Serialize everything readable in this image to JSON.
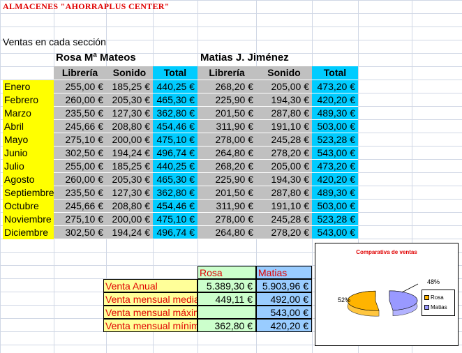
{
  "sheet": {
    "title": "ALMACENES \"AHORRAPLUS CENTER\"",
    "subtitle": "Ventas en cada sección",
    "persons": [
      "Rosa Mª Mateos",
      "Matias J. Jiménez"
    ],
    "columns": [
      "Librería",
      "Sonido",
      "Total",
      "Librería",
      "Sonido",
      "Total"
    ],
    "rows": [
      {
        "month": "Enero",
        "v": [
          "255,00 €",
          "185,25 €",
          "440,25 €",
          "268,20 €",
          "205,00 €",
          "473,20 €"
        ]
      },
      {
        "month": "Febrero",
        "v": [
          "260,00 €",
          "205,30 €",
          "465,30 €",
          "225,90 €",
          "194,30 €",
          "420,20 €"
        ]
      },
      {
        "month": "Marzo",
        "v": [
          "235,50 €",
          "127,30 €",
          "362,80 €",
          "201,50 €",
          "287,80 €",
          "489,30 €"
        ]
      },
      {
        "month": "Abril",
        "v": [
          "245,66 €",
          "208,80 €",
          "454,46 €",
          "311,90 €",
          "191,10 €",
          "503,00 €"
        ]
      },
      {
        "month": "Mayo",
        "v": [
          "275,10 €",
          "200,00 €",
          "475,10 €",
          "278,00 €",
          "245,28 €",
          "523,28 €"
        ]
      },
      {
        "month": "Junio",
        "v": [
          "302,50 €",
          "194,24 €",
          "496,74 €",
          "264,80 €",
          "278,20 €",
          "543,00 €"
        ]
      },
      {
        "month": "Julio",
        "v": [
          "255,00 €",
          "185,25 €",
          "440,25 €",
          "268,20 €",
          "205,00 €",
          "473,20 €"
        ]
      },
      {
        "month": "Agosto",
        "v": [
          "260,00 €",
          "205,30 €",
          "465,30 €",
          "225,90 €",
          "194,30 €",
          "420,20 €"
        ]
      },
      {
        "month": "Septiembre",
        "v": [
          "235,50 €",
          "127,30 €",
          "362,80 €",
          "201,50 €",
          "287,80 €",
          "489,30 €"
        ]
      },
      {
        "month": "Octubre",
        "v": [
          "245,66 €",
          "208,80 €",
          "454,46 €",
          "311,90 €",
          "191,10 €",
          "503,00 €"
        ]
      },
      {
        "month": "Noviembre",
        "v": [
          "275,10 €",
          "200,00 €",
          "475,10 €",
          "278,00 €",
          "245,28 €",
          "523,28 €"
        ]
      },
      {
        "month": "Diciembre",
        "v": [
          "302,50 €",
          "194,24 €",
          "496,74 €",
          "264,80 €",
          "278,20 €",
          "543,00 €"
        ]
      }
    ]
  },
  "summary": {
    "head_rosa": "Rosa",
    "head_matias": "Matias",
    "rows": [
      {
        "label": "Venta Anual",
        "rosa": "5.389,30 €",
        "matias": "5.903,96 €"
      },
      {
        "label": "Venta mensual media",
        "rosa": "449,11 €",
        "matias": "492,00 €"
      },
      {
        "label": "Venta mensual máxima",
        "rosa": "",
        "matias": "543,00 €"
      },
      {
        "label": "Venta mensual mínima",
        "rosa": "362,80 €",
        "matias": "420,20 €"
      }
    ]
  },
  "chart": {
    "title": "Comparativa de ventas",
    "label_rosa": "52%",
    "label_matias": "48%",
    "legend": [
      "Rosa",
      "Matias"
    ],
    "colors": {
      "rosa": "#ffb400",
      "matias": "#9999ff"
    }
  },
  "chart_data": {
    "type": "pie",
    "title": "Comparativa de ventas",
    "categories": [
      "Rosa",
      "Matias"
    ],
    "values": [
      52,
      48
    ],
    "legend": "right"
  }
}
